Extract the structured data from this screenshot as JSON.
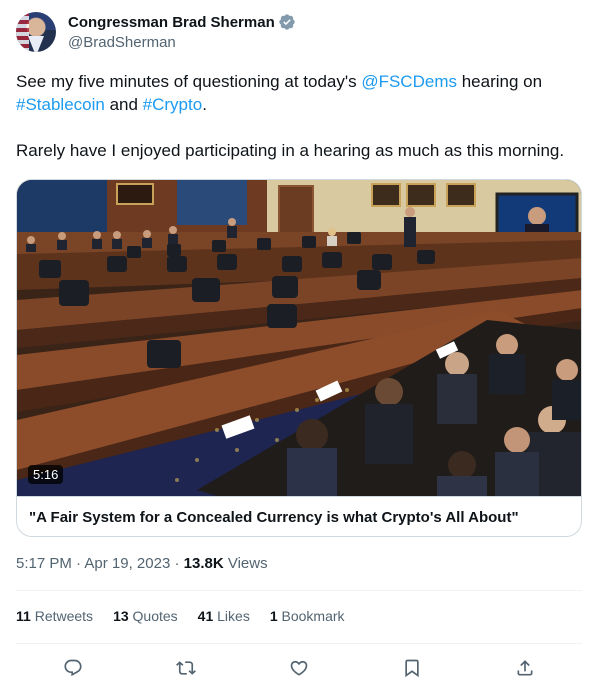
{
  "author": {
    "display_name": "Congressman Brad Sherman",
    "handle": "@BradSherman",
    "verified": true
  },
  "tweet": {
    "line1_prefix": "See my five minutes of questioning at today's ",
    "mention": "@FSCDems",
    "line1_suffix": " hearing on",
    "hashtag1": "#Stablecoin",
    "and_text": " and ",
    "hashtag2": "#Crypto",
    "period": ".",
    "line2": "Rarely have I enjoyed participating in a hearing as much as this morning."
  },
  "media": {
    "duration": "5:16",
    "caption": "\"A Fair System for a Concealed Currency is what Crypto's All About\""
  },
  "meta": {
    "time": "5:17 PM",
    "date": "Apr 19, 2023",
    "views_count": "13.8K",
    "views_label": "Views"
  },
  "stats": {
    "retweets_count": "11",
    "retweets_label": "Retweets",
    "quotes_count": "13",
    "quotes_label": "Quotes",
    "likes_count": "41",
    "likes_label": "Likes",
    "bookmarks_count": "1",
    "bookmarks_label": "Bookmark"
  },
  "actions": [
    "reply-icon",
    "retweet-icon",
    "like-icon",
    "bookmark-icon",
    "share-icon"
  ],
  "colors": {
    "link": "#1d9bf0",
    "text": "#0f1419",
    "muted": "#536471",
    "border": "#cfd9de"
  }
}
